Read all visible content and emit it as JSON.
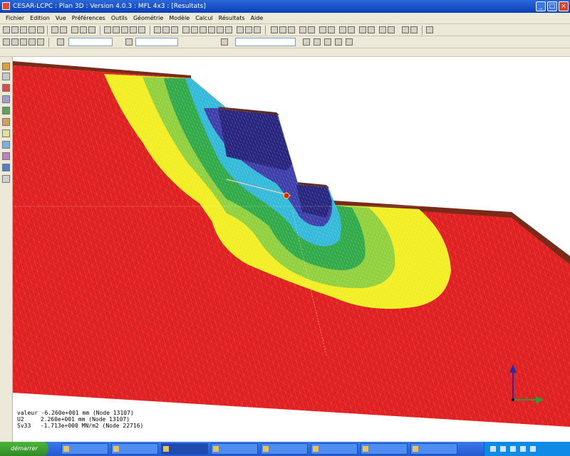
{
  "window": {
    "title": "CESAR-LCPC : Plan 3D : Version 4.0.3 : MFL 4x3 : [Resultats]",
    "buttons": {
      "minimize": "_",
      "maximize": "□",
      "close": "×"
    }
  },
  "menu": [
    "Fichier",
    "Edition",
    "Vue",
    "Préférences",
    "Outils",
    "Géométrie",
    "Modèle",
    "Calcul",
    "Résultats",
    "Aide"
  ],
  "readout": {
    "line1": "valeur  -6.260e+001 mm (Node 13107)",
    "line1_label": "valeur",
    "line1_value": "-6.260e+001 mm (Node 13107)",
    "u_label": "U2",
    "u_value": "2.260e+001 mm (Node 13107)",
    "s_label": "Sv33",
    "s_value": "-1.713e+000 MN/m2 (Node 22716)"
  },
  "taskbar": {
    "start_label": "démarrer",
    "tasks": [
      "",
      "",
      "",
      "",
      "",
      "",
      "",
      ""
    ]
  },
  "colors": {
    "red": "#e02020",
    "yellow": "#f2ee1e",
    "light_green": "#8fcf3a",
    "green": "#2da845",
    "cyan": "#2fb8d8",
    "blue": "#3a3aa8",
    "dark_blue": "#22207a",
    "wall_brown": "#7a2a18"
  }
}
